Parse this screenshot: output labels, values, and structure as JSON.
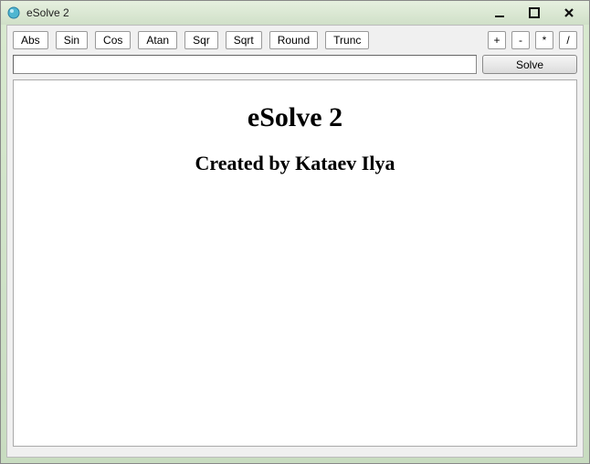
{
  "window": {
    "title": "eSolve 2"
  },
  "toolbar": {
    "functions": [
      "Abs",
      "Sin",
      "Cos",
      "Atan",
      "Sqr",
      "Sqrt",
      "Round",
      "Trunc"
    ],
    "operators": [
      "+",
      "-",
      "*",
      "/"
    ]
  },
  "input": {
    "expression_value": "",
    "solve_label": "Solve"
  },
  "content": {
    "title": "eSolve 2",
    "subtitle": "Created by Kataev Ilya"
  }
}
